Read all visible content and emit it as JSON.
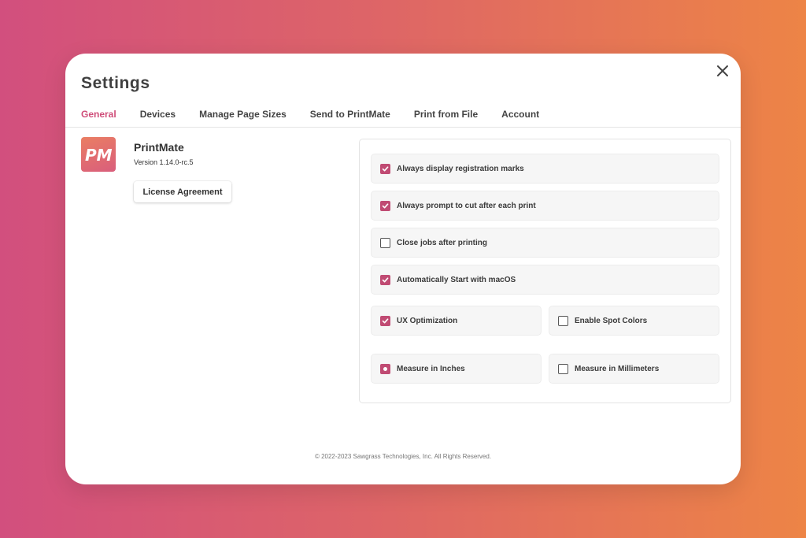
{
  "window": {
    "title": "Settings"
  },
  "tabs": [
    {
      "label": "General",
      "active": true
    },
    {
      "label": "Devices"
    },
    {
      "label": "Manage Page Sizes"
    },
    {
      "label": "Send to PrintMate"
    },
    {
      "label": "Print from File"
    },
    {
      "label": "Account"
    }
  ],
  "app": {
    "logo_letters": "PM",
    "name": "PrintMate",
    "version": "Version 1.14.0-rc.5",
    "license_button": "License Agreement"
  },
  "options": [
    {
      "label": "Always display registration marks",
      "checked": true
    },
    {
      "label": "Always prompt to cut after each print",
      "checked": true
    },
    {
      "label": "Close jobs after printing",
      "checked": false
    },
    {
      "label": "Automatically Start with macOS",
      "checked": true
    },
    {
      "label": "UX Optimization",
      "checked": true
    },
    {
      "label": "Enable Spot Colors",
      "checked": false
    }
  ],
  "measure": [
    {
      "label": "Measure in Inches",
      "selected": true
    },
    {
      "label": "Measure in Millimeters",
      "selected": false
    }
  ],
  "footer": {
    "copyright": "© 2022-2023 Sawgrass Technologies, Inc. All Rights Reserved."
  },
  "colors": {
    "accent": "#c04b73",
    "active_tab": "#cf4d79",
    "background_start": "#d24f7e",
    "background_end": "#ed8446"
  }
}
